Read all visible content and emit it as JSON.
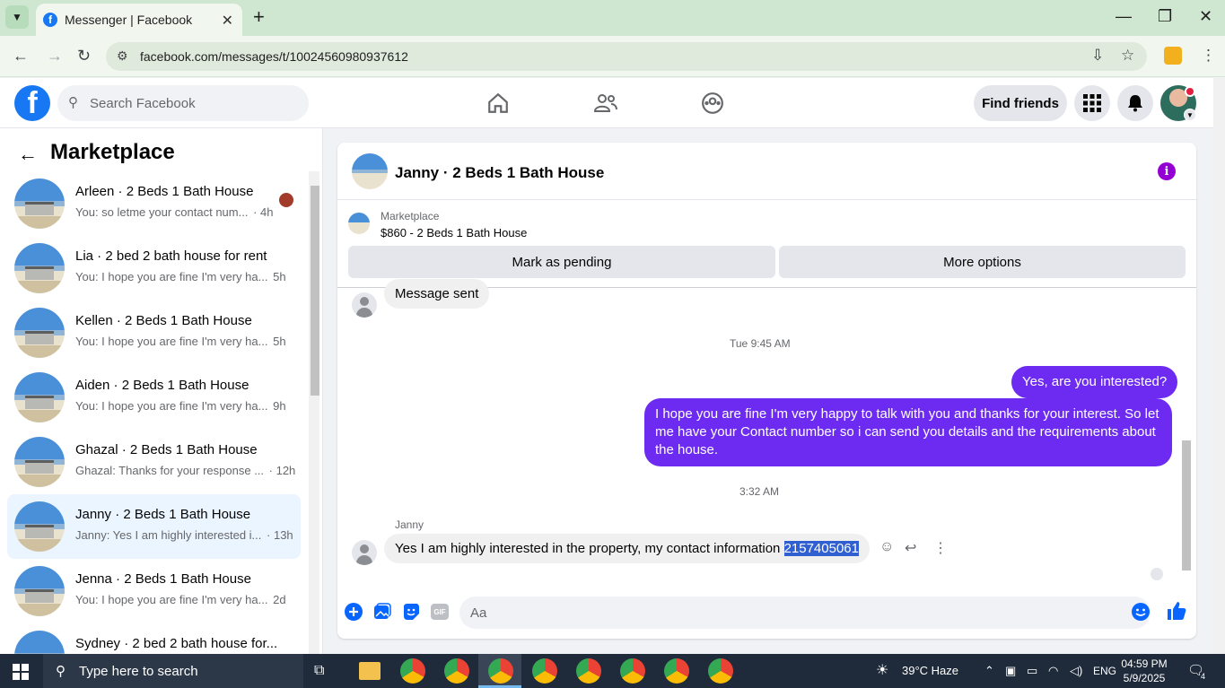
{
  "browser": {
    "tab_title": "Messenger | Facebook",
    "url": "facebook.com/messages/t/10024560980937612"
  },
  "fb": {
    "logo": "f",
    "search_placeholder": "Search Facebook",
    "find_friends": "Find friends"
  },
  "sidebar": {
    "title": "Marketplace",
    "conversations": [
      {
        "title": "Arleen · 2 Beds 1 Bath House",
        "preview": "You: so letme your contact num...",
        "time": "· 4h"
      },
      {
        "title": "Lia · 2 bed 2 bath house for rent",
        "preview": "You: I hope you are fine I'm very ha...",
        "time": "5h"
      },
      {
        "title": "Kellen · 2 Beds 1 Bath House",
        "preview": "You: I hope you are fine I'm very ha...",
        "time": "5h"
      },
      {
        "title": "Aiden · 2 Beds 1 Bath House",
        "preview": "You: I hope you are fine I'm very ha...",
        "time": "9h"
      },
      {
        "title": "Ghazal · 2 Beds 1 Bath House",
        "preview": "Ghazal: Thanks for your response ...",
        "time": "· 12h"
      },
      {
        "title": "Janny · 2 Beds 1 Bath House",
        "preview": "Janny: Yes I am highly interested i...",
        "time": "· 13h"
      },
      {
        "title": "Jenna · 2 Beds 1 Bath House",
        "preview": "You: I hope you are fine I'm very ha...",
        "time": "2d"
      },
      {
        "title": "Sydney · 2 bed 2 bath house for...",
        "preview": "",
        "time": ""
      }
    ]
  },
  "chat": {
    "title": "Janny · 2 Beds 1 Bath House",
    "marketplace_label": "Marketplace",
    "listing": "$860 - 2 Beds 1 Bath House",
    "mark_pending": "Mark as pending",
    "more_options": "More options",
    "message_sent": "Message sent",
    "timestamp1": "Tue 9:45 AM",
    "out1": "Yes, are you interested?",
    "out2": "I hope you are fine I'm very happy to talk with you and thanks for your interest. So let me have your Contact number so i can send you details and the requirements about the house.",
    "timestamp2": "3:32 AM",
    "sender": "Janny",
    "in_text": "Yes I am highly interested in the property, my contact information ",
    "in_number": "2157405061",
    "composer_placeholder": "Aa",
    "gif": "GIF"
  },
  "taskbar": {
    "search": "Type here to search",
    "weather": "39°C  Haze",
    "lang": "ENG",
    "time": "04:59 PM",
    "date": "5/9/2025",
    "notif_count": "4"
  },
  "colors": {
    "fb_blue": "#1877f2",
    "messenger_purple": "#6d2bf2",
    "active_conv_bg": "#ebf5ff"
  }
}
